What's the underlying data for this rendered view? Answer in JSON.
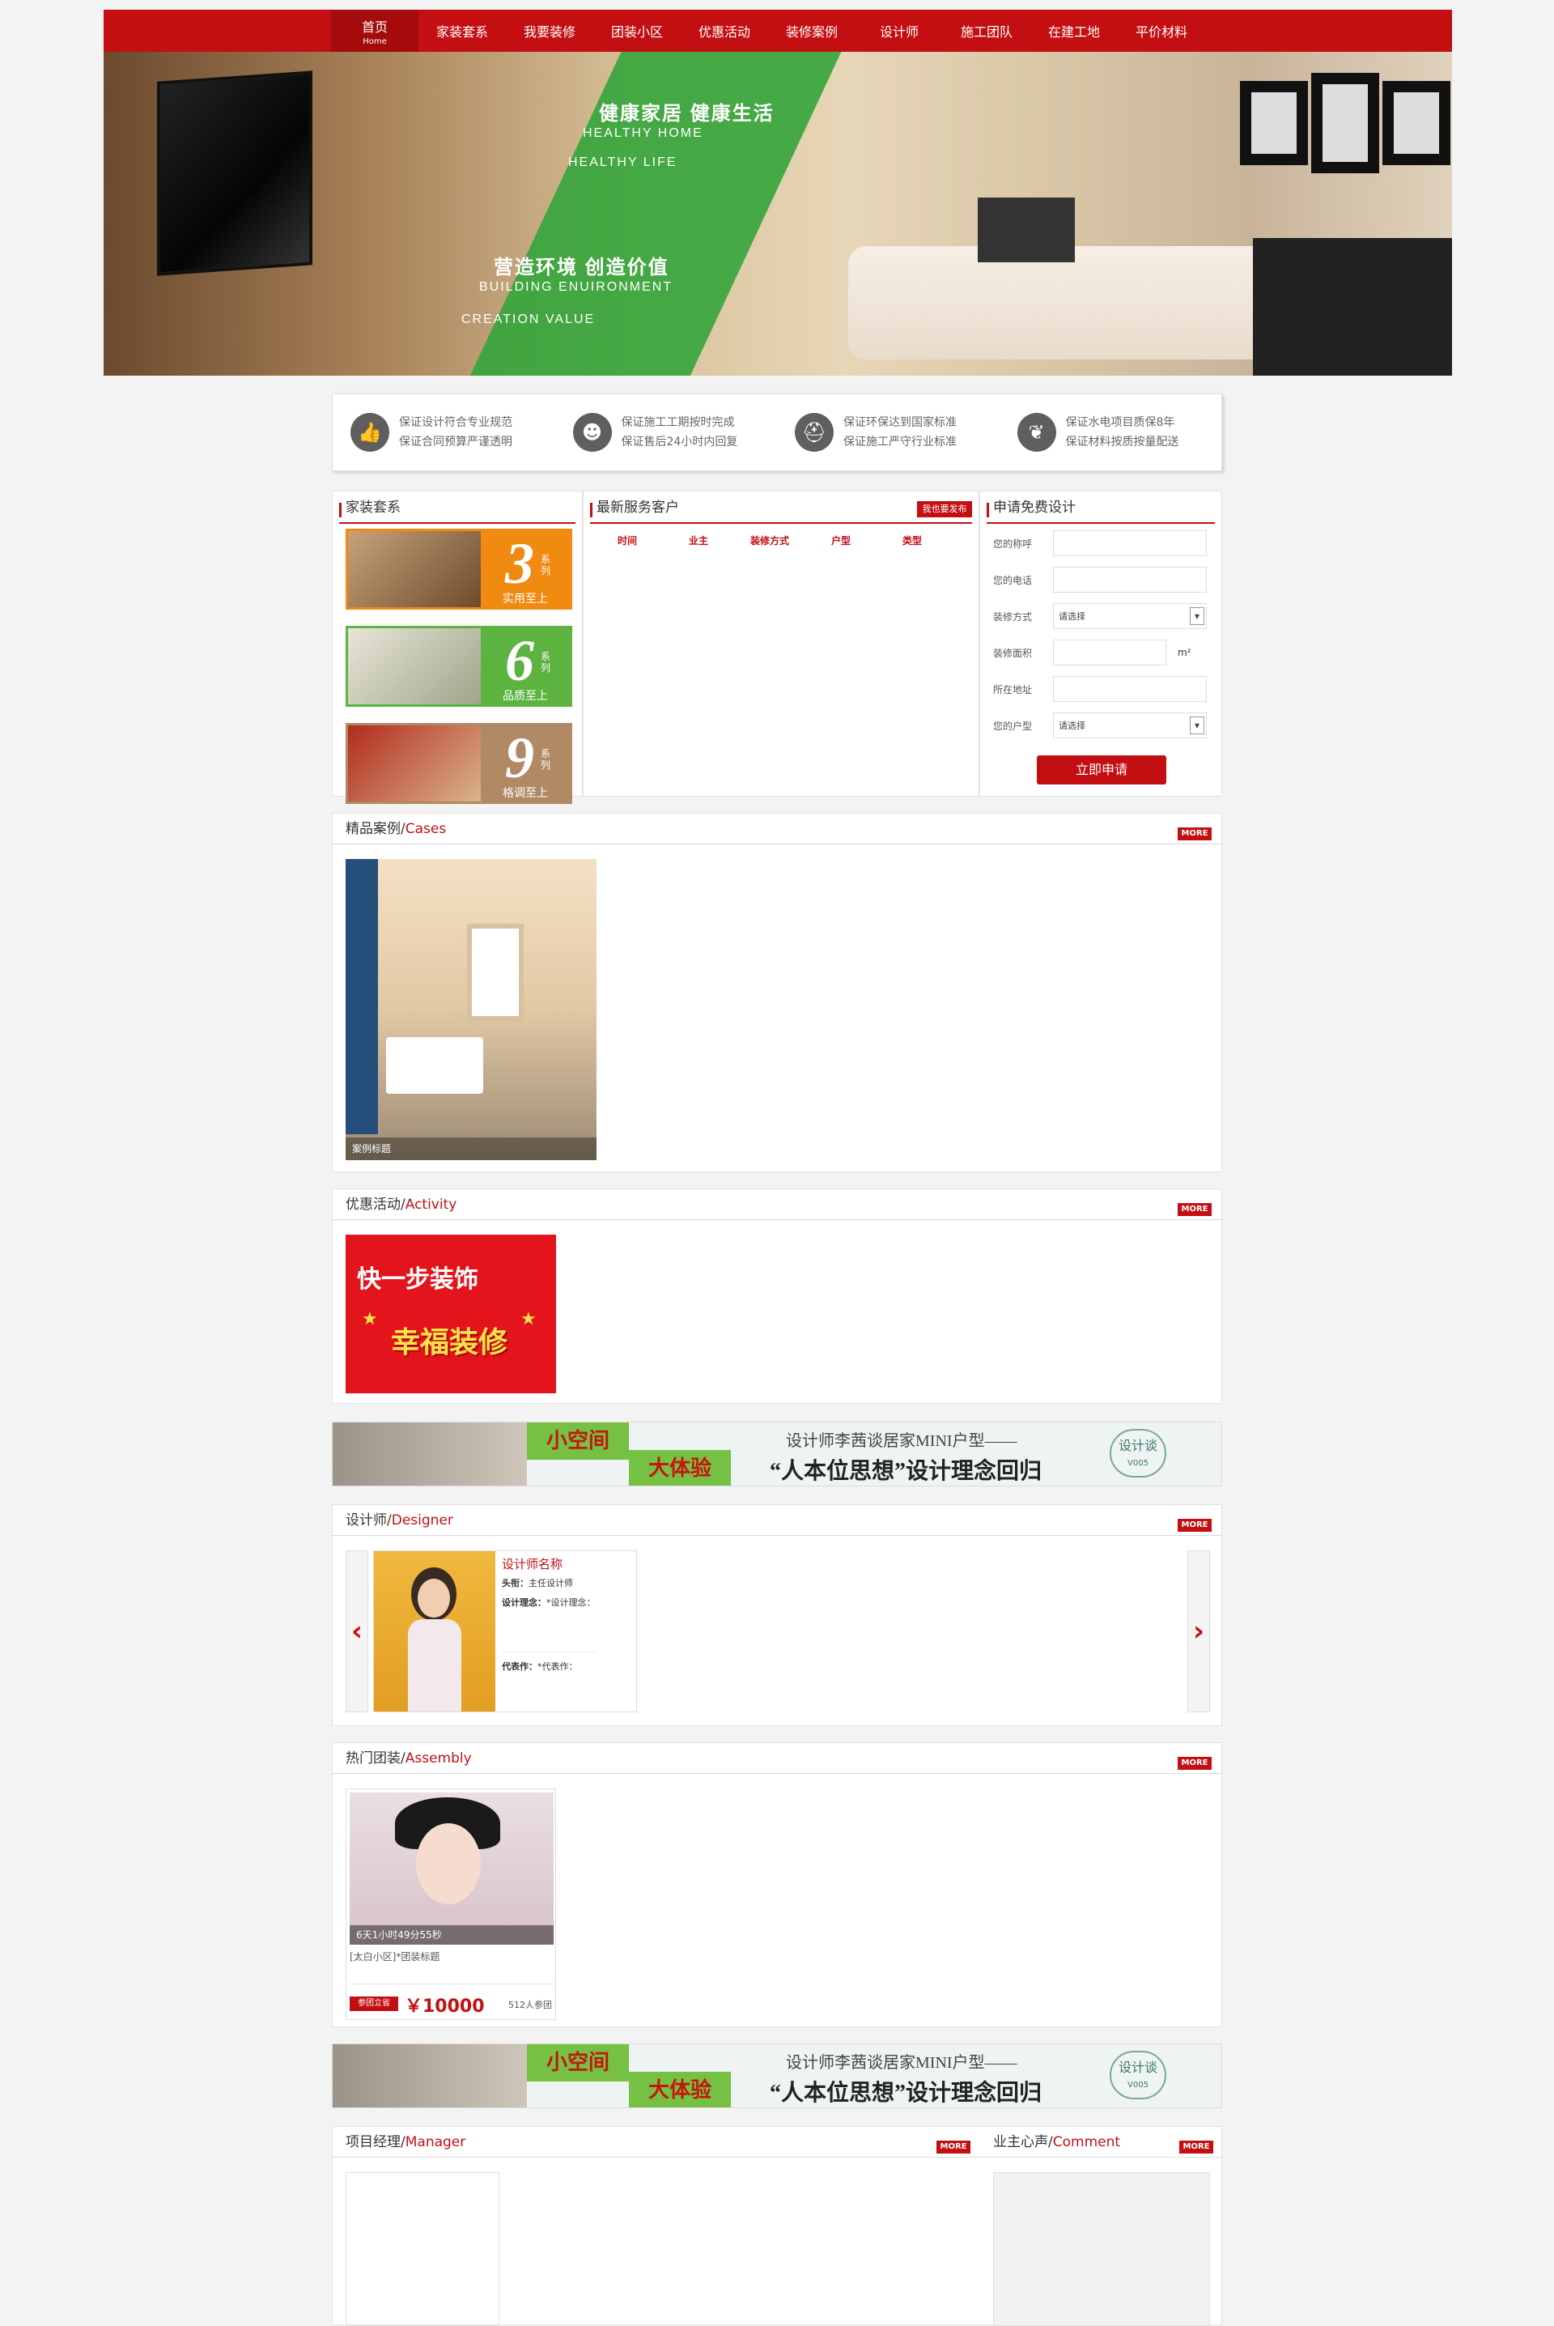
{
  "nav": {
    "items": [
      {
        "label": "首页",
        "sub": "Home"
      },
      {
        "label": "家装套系"
      },
      {
        "label": "我要装修"
      },
      {
        "label": "团装小区"
      },
      {
        "label": "优惠活动"
      },
      {
        "label": "装修案例"
      },
      {
        "label": "设计师"
      },
      {
        "label": "施工团队"
      },
      {
        "label": "在建工地"
      },
      {
        "label": "平价材料"
      }
    ]
  },
  "banner": {
    "line1": "健康家居  健康生活",
    "line2": "HEALTHY HOME",
    "line3": "HEALTHY LIFE",
    "line4": "营造环境  创造价值",
    "line5": "BUILDING ENUIRONMENT",
    "line6": "CREATION VALUE"
  },
  "guarantees": [
    {
      "icon": "thumb-up-icon",
      "glyph": "👍",
      "l1": "保证设计符合专业规范",
      "l2": "保证合同预算严谨透明"
    },
    {
      "icon": "person-icon",
      "glyph": "☻",
      "l1": "保证施工工期按时完成",
      "l2": "保证售后24小时内回复"
    },
    {
      "icon": "helmet-icon",
      "glyph": "⛑",
      "l1": "保证环保达到国家标准",
      "l2": "保证施工严守行业标准"
    },
    {
      "icon": "leaf-icon",
      "glyph": "❦",
      "l1": "保证水电项目质保8年",
      "l2": "保证材料按质按量配送"
    }
  ],
  "series_panel": {
    "title": "家装套系",
    "items": [
      {
        "num": "3",
        "xl": "系列",
        "cap": "实用至上",
        "color": "#f08a10"
      },
      {
        "num": "6",
        "xl": "系列",
        "cap": "品质至上",
        "color": "#5cb340"
      },
      {
        "num": "9",
        "xl": "系列",
        "cap": "格调至上",
        "color": "#b08a64"
      }
    ]
  },
  "clients_panel": {
    "title": "最新服务客户",
    "publish": "我也要发布",
    "columns": [
      "时间",
      "业主",
      "装修方式",
      "户型",
      "类型"
    ]
  },
  "form": {
    "title": "申请免费设计",
    "fields": [
      {
        "label": "您的称呼",
        "value": ""
      },
      {
        "label": "您的电话",
        "value": ""
      },
      {
        "label": "装修方式",
        "value": "请选择",
        "select": true
      },
      {
        "label": "装修面积",
        "value": "",
        "unit": "m²"
      },
      {
        "label": "所在地址",
        "value": ""
      },
      {
        "label": "您的户型",
        "value": "请选择",
        "select": true
      }
    ],
    "submit": "立即申请"
  },
  "cases": {
    "title_cn": "精品案例/",
    "title_en": "Cases",
    "more": "MORE",
    "item_caption": "案例标题"
  },
  "activity": {
    "title_cn": "优惠活动/",
    "title_en": "Activity",
    "more": "MORE",
    "ad_text": "快一步装饰",
    "ad_sub": "幸福装修"
  },
  "adbanner": {
    "green1": "小空间",
    "green2": "大体验",
    "line1": "设计师李茜谈居家MINI户型——",
    "line2": "“人本位思想”设计理念回归",
    "badge": "设计谈",
    "badge_sub": "V005"
  },
  "designer": {
    "title_cn": "设计师/",
    "title_en": "Designer",
    "more": "MORE",
    "name": "设计师名称",
    "title_label": "头衔：",
    "title_value": "主任设计师",
    "idea_label": "设计理念：",
    "idea_value": "*设计理念：",
    "work_label": "代表作：",
    "work_value": "*代表作："
  },
  "assembly": {
    "title_cn": "热门团装/",
    "title_en": "Assembly",
    "more": "MORE",
    "timer": "6天1小时49分55秒",
    "caption": "[太白小区]*团装标题",
    "join": "参团立省",
    "price": "￥10000",
    "count": "512人参团"
  },
  "manager": {
    "title_cn": "项目经理/",
    "title_en": "Manager",
    "more": "MORE"
  },
  "comment": {
    "title_cn": "业主心声/",
    "title_en": "Comment",
    "more": "MORE"
  }
}
